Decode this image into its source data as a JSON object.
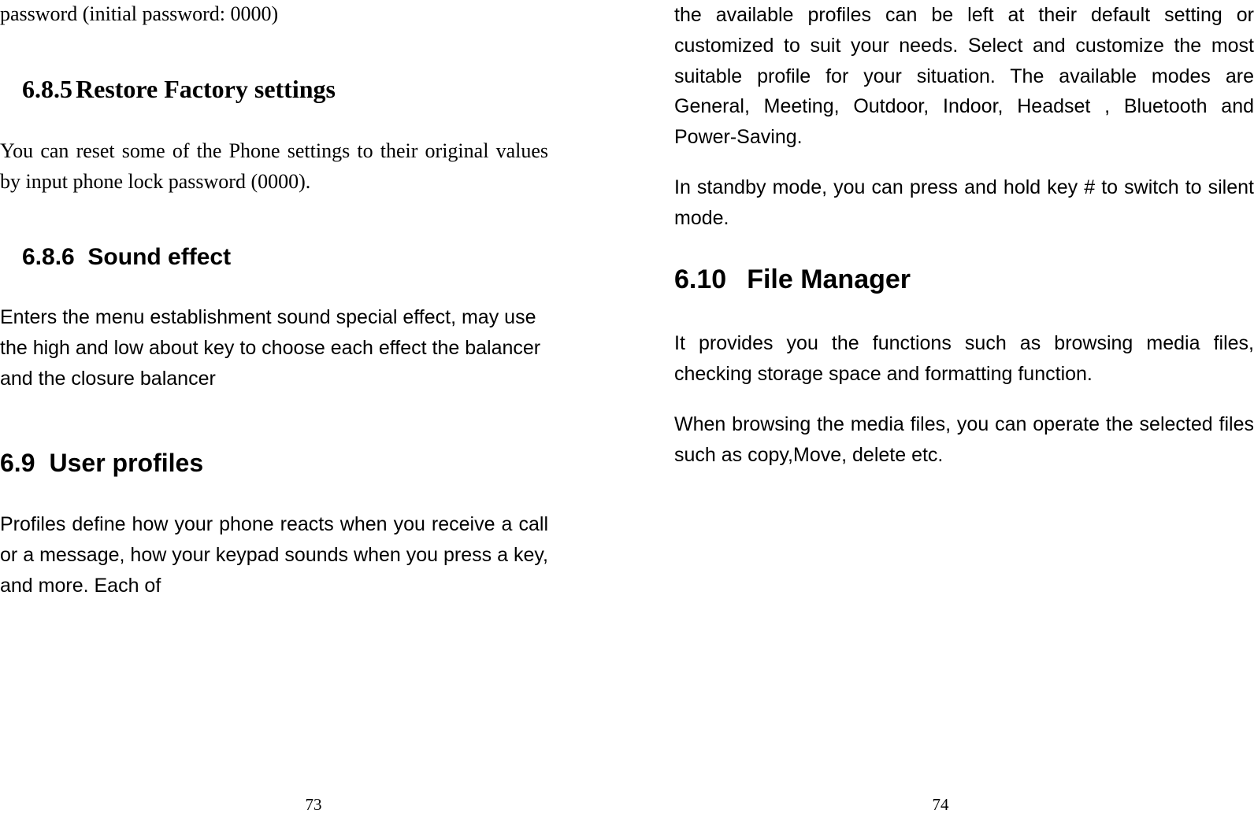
{
  "left": {
    "fragment": "password (initial password: 0000)",
    "s685": {
      "num": "6.8.5",
      "title": "Restore Factory settings",
      "body": "You can reset some of the Phone settings to their original values by input phone lock password (0000)."
    },
    "s686": {
      "num": "6.8.6",
      "title": "Sound effect",
      "body": "Enters the menu establishment sound special effect, may use the high and low about key to choose each effect the balancer and the closure balancer"
    },
    "s69": {
      "num": "6.9",
      "title": "User profiles",
      "body": "Profiles define how your phone reacts when you receive a call or a message, how your keypad sounds when you press a key, and more. Each of"
    },
    "pagenum": "73"
  },
  "right": {
    "cont1": "the available profiles can be left at their default setting or customized to suit your needs. Select and customize the most suitable profile for your situation. The available modes are General, Meeting, Outdoor, Indoor, Headset , Bluetooth and Power-Saving.",
    "cont2": "In standby mode, you can press and hold key # to switch to silent mode.",
    "s610": {
      "num": "6.10",
      "title": "File Manager",
      "body1": "It provides you the functions such as browsing media files, checking storage space and formatting function.",
      "body2": "When browsing the media files, you can operate the selected files such as copy,Move, delete etc."
    },
    "pagenum": "74"
  }
}
